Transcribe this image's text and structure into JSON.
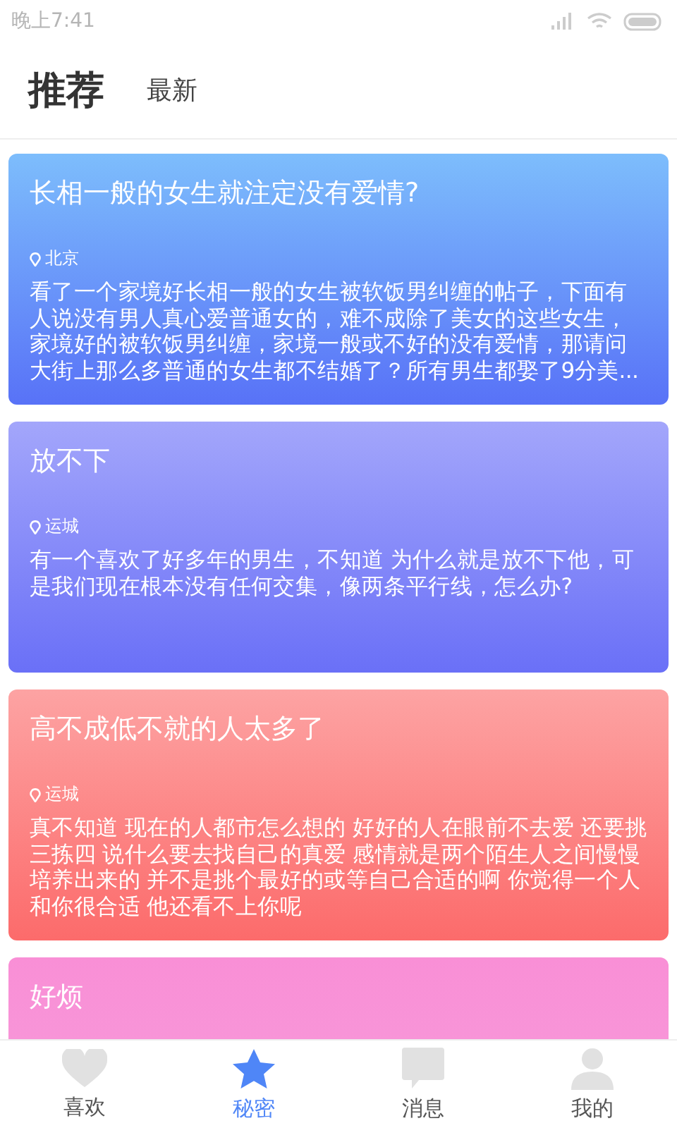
{
  "status_bar": {
    "time": "晚上7:41"
  },
  "header_tabs": [
    {
      "label": "推荐",
      "selected": true
    },
    {
      "label": "最新",
      "selected": false
    }
  ],
  "posts": [
    {
      "title": "长相一般的女生就注定没有爱情?",
      "location": "北京",
      "body": "看了一个家境好长相一般的女生被软饭男纠缠的帖子，下面有人说没有男人真心爱普通女的，难不成除了美女的这些女生，家境好的被软饭男纠缠，家境一般或不好的没有爱情，那请问大街上那么多普通的女生都不结婚了？所有男生都娶了9分美..."
    },
    {
      "title": "放不下",
      "location": "运城",
      "body": "有一个喜欢了好多年的男生，不知道 为什么就是放不下他，可是我们现在根本没有任何交集，像两条平行线，怎么办?"
    },
    {
      "title": "高不成低不就的人太多了",
      "location": "运城",
      "body": "真不知道 现在的人都市怎么想的 好好的人在眼前不去爱 还要挑三拣四 说什么要去找自己的真爱 感情就是两个陌生人之间慢慢培养出来的 并不是挑个最好的或等自己合适的啊 你觉得一个人和你很合适 他还看不上你呢"
    },
    {
      "title": "好烦"
    }
  ],
  "bottom_nav": [
    {
      "label": "喜欢",
      "kind": "heart",
      "selected": false
    },
    {
      "label": "秘密",
      "kind": "star",
      "selected": true
    },
    {
      "label": "消息",
      "kind": "chat",
      "selected": false
    },
    {
      "label": "我的",
      "kind": "person",
      "selected": false
    }
  ]
}
